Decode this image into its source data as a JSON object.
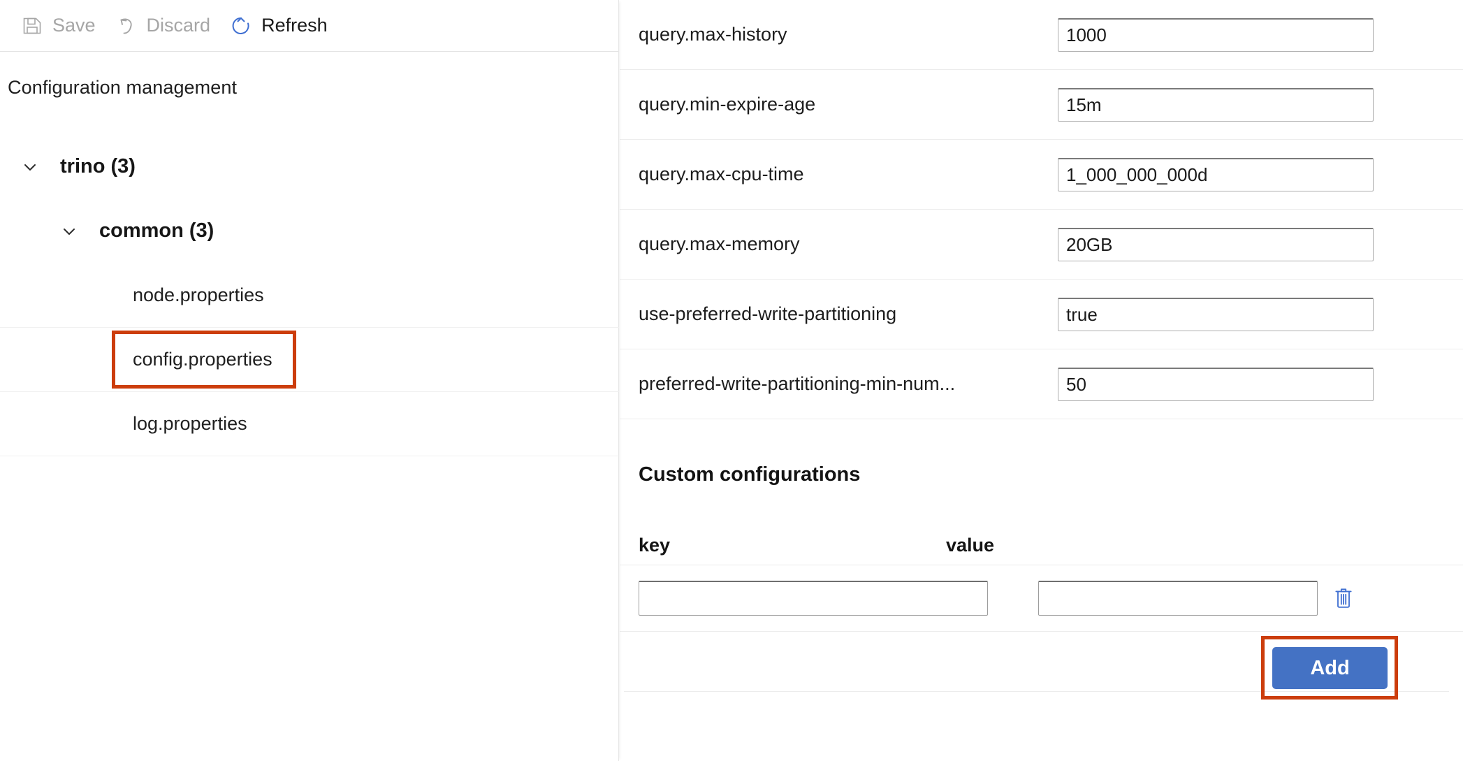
{
  "toolbar": {
    "save": {
      "label": "Save",
      "icon": "save-icon",
      "enabled": false
    },
    "discard": {
      "label": "Discard",
      "icon": "undo-icon",
      "enabled": false
    },
    "refresh": {
      "label": "Refresh",
      "icon": "refresh-icon",
      "enabled": true
    }
  },
  "left": {
    "section_title": "Configuration management",
    "tree": [
      {
        "label": "trino (3)",
        "level": 0,
        "expanded": true,
        "bold": true
      },
      {
        "label": "common (3)",
        "level": 1,
        "expanded": true,
        "bold": true
      },
      {
        "label": "node.properties",
        "level": 2,
        "expanded": false,
        "bold": false
      },
      {
        "label": "config.properties",
        "level": 2,
        "expanded": false,
        "bold": false,
        "highlighted": true,
        "selected": true
      },
      {
        "label": "log.properties",
        "level": 2,
        "expanded": false,
        "bold": false
      }
    ]
  },
  "right": {
    "configs": [
      {
        "key": "query.max-history",
        "value": "1000"
      },
      {
        "key": "query.min-expire-age",
        "value": "15m"
      },
      {
        "key": "query.max-cpu-time",
        "value": "1_000_000_000d"
      },
      {
        "key": "query.max-memory",
        "value": "20GB"
      },
      {
        "key": "use-preferred-write-partitioning",
        "value": "true"
      },
      {
        "key": "preferred-write-partitioning-min-num...",
        "value": "50"
      }
    ],
    "custom": {
      "heading": "Custom configurations",
      "columns": {
        "key": "key",
        "value": "value"
      },
      "rows": [
        {
          "key": "",
          "value": "",
          "key_placeholder": "",
          "value_placeholder": "",
          "delete_icon": "trash-icon"
        }
      ],
      "add_label": "Add"
    }
  },
  "colors": {
    "accent_blue": "#4472c4",
    "annotation_red": "#cc3d0c",
    "icon_blue": "#3f6fd1",
    "disabled_text": "#a6a6a6",
    "text": "#1f1f1f",
    "rule": "#ececec"
  }
}
